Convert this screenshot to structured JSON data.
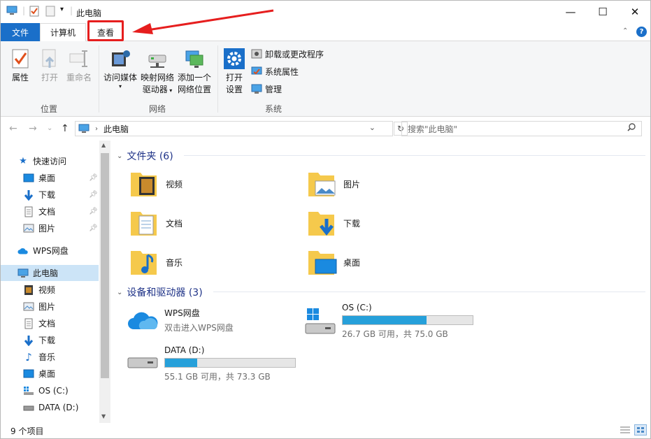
{
  "window": {
    "title": "此电脑",
    "minimize_glyph": "—",
    "maximize_glyph": "☐",
    "close_glyph": "✕"
  },
  "tabs": {
    "file": "文件",
    "computer": "计算机",
    "view": "查看"
  },
  "ribbon": {
    "location": {
      "label": "位置",
      "properties": "属性",
      "open": "打开",
      "rename": "重命名"
    },
    "network": {
      "label": "网络",
      "access_media": "访问媒体",
      "map_drive_1": "映射网络",
      "map_drive_2": "驱动器",
      "add_location_1": "添加一个",
      "add_location_2": "网络位置"
    },
    "system": {
      "label": "系统",
      "open_settings_1": "打开",
      "open_settings_2": "设置",
      "uninstall": "卸载或更改程序",
      "system_properties": "系统属性",
      "manage": "管理"
    }
  },
  "address": {
    "path": "此电脑",
    "search_placeholder": "搜索\"此电脑\""
  },
  "nav": {
    "quick_access": "快速访问",
    "quick_items": [
      "桌面",
      "下载",
      "文档",
      "图片"
    ],
    "wps": "WPS网盘",
    "this_pc": "此电脑",
    "pc_items": [
      "视频",
      "图片",
      "文档",
      "下载",
      "音乐",
      "桌面",
      "OS (C:)",
      "DATA (D:)"
    ]
  },
  "content": {
    "folders_header": "文件夹 (6)",
    "folders": [
      "视频",
      "图片",
      "文档",
      "下载",
      "音乐",
      "桌面"
    ],
    "drives_header": "设备和驱动器 (3)",
    "wps_drive": {
      "name": "WPS网盘",
      "sub": "双击进入WPS网盘"
    },
    "drive_c": {
      "name": "OS (C:)",
      "sub": "26.7 GB 可用，共 75.0 GB",
      "used_fraction": 0.644
    },
    "drive_d": {
      "name": "DATA (D:)",
      "sub": "55.1 GB 可用，共 73.3 GB",
      "used_fraction": 0.248
    }
  },
  "status": {
    "item_count": "9 个项目"
  },
  "colors": {
    "accent": "#1a6fc9",
    "highlight": "#e61e1e",
    "drive_fill": "#26a0da",
    "selected": "#cce4f7"
  }
}
